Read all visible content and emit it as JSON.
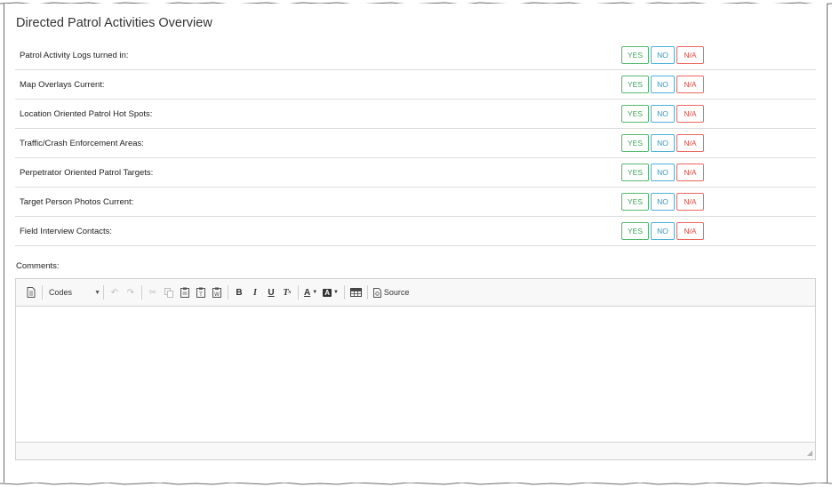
{
  "panel": {
    "title": "Directed Patrol Activities Overview"
  },
  "options": {
    "yes": "YES",
    "no": "NO",
    "na": "N/A"
  },
  "checklist": [
    {
      "label": "Patrol Activity Logs turned in:"
    },
    {
      "label": "Map Overlays Current:"
    },
    {
      "label": "Location Oriented Patrol Hot Spots:"
    },
    {
      "label": "Traffic/Crash Enforcement Areas:"
    },
    {
      "label": "Perpetrator Oriented Patrol Targets:"
    },
    {
      "label": "Target Person Photos Current:"
    },
    {
      "label": "Field Interview Contacts:"
    }
  ],
  "comments": {
    "label": "Comments:",
    "editor": {
      "format_combo": "Codes",
      "source_label": "Source",
      "value": ""
    }
  },
  "colors": {
    "yes": "#3fa55b",
    "no": "#2a98c9",
    "na": "#e0483f"
  }
}
